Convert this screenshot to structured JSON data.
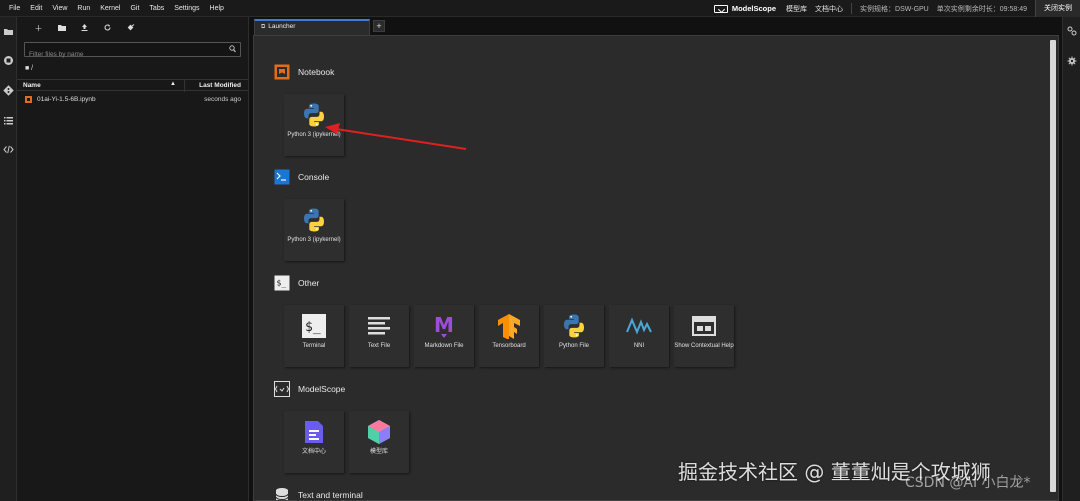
{
  "menubar": {
    "items": [
      "File",
      "Edit",
      "View",
      "Run",
      "Kernel",
      "Git",
      "Tabs",
      "Settings",
      "Help"
    ],
    "brand": "ModelScope",
    "links": [
      "模型库",
      "文档中心"
    ],
    "instance_spec": "实例规格：DSW-GPU",
    "remaining_time": "单次实例剩余时长：09:58:49",
    "close_button": "关闭实例"
  },
  "filebrowser": {
    "search_placeholder": "Filter files by name",
    "breadcrumb": "■ /",
    "col_name": "Name",
    "col_modified": "Last Modified",
    "files": [
      {
        "name": "01ai-Yi-1.5-6B.ipynb",
        "modified": "seconds ago"
      }
    ]
  },
  "tabs": [
    {
      "label": "Launcher"
    }
  ],
  "tab_add": "+",
  "launcher": {
    "sections": [
      {
        "title": "Notebook",
        "cards": [
          {
            "label": "Python 3 (ipykernel)",
            "icon": "python-icon"
          }
        ]
      },
      {
        "title": "Console",
        "cards": [
          {
            "label": "Python 3 (ipykernel)",
            "icon": "python-icon"
          }
        ]
      },
      {
        "title": "Other",
        "cards": [
          {
            "label": "Terminal",
            "icon": "terminal-icon"
          },
          {
            "label": "Text File",
            "icon": "text-file-icon"
          },
          {
            "label": "Markdown File",
            "icon": "markdown-icon"
          },
          {
            "label": "Tensorboard",
            "icon": "tensorflow-icon"
          },
          {
            "label": "Python File",
            "icon": "python-icon"
          },
          {
            "label": "NNI",
            "icon": "nni-icon"
          },
          {
            "label": "Show Contextual Help",
            "icon": "contextual-help-icon"
          }
        ]
      },
      {
        "title": "ModelScope",
        "cards": [
          {
            "label": "文档中心",
            "icon": "docs-icon"
          },
          {
            "label": "模型库",
            "icon": "model-hub-icon"
          }
        ]
      },
      {
        "title": "Text and terminal",
        "cards": []
      }
    ]
  },
  "watermark": "掘金技术社区 @ 董董灿是个攻城狮",
  "watermark2": "CSDN @AI 小白龙*",
  "colors": {
    "accent": "#3f7bd3",
    "notebook_orange": "#e06c1c",
    "arrow_red": "#e02020"
  }
}
